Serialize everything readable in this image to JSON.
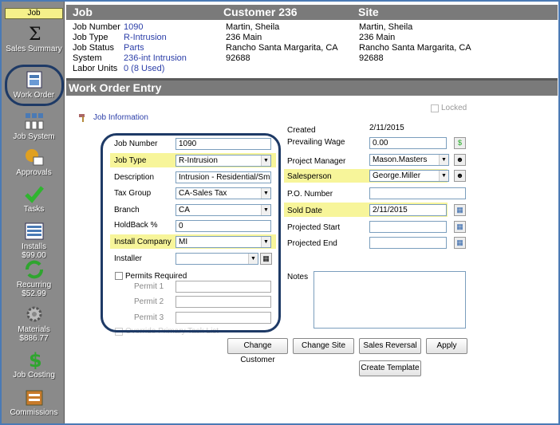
{
  "sidebar": {
    "tab": "Job",
    "items": [
      {
        "label": "Sales Summary",
        "icon": "sigma-icon"
      },
      {
        "label": "Work Order",
        "icon": "work-order-icon"
      },
      {
        "label": "Job System",
        "icon": "job-system-icon"
      },
      {
        "label": "Approvals",
        "icon": "approvals-icon"
      },
      {
        "label": "Tasks",
        "icon": "checkmark-icon"
      },
      {
        "label": "Installs",
        "sub": "$99.00",
        "icon": "installs-icon"
      },
      {
        "label": "Recurring",
        "sub": "$52.99",
        "icon": "recurring-icon"
      },
      {
        "label": "Materials",
        "sub": "$886.77",
        "icon": "gear-icon"
      },
      {
        "label": "Job Costing",
        "icon": "dollar-icon"
      },
      {
        "label": "Commissions",
        "icon": "commissions-icon"
      }
    ]
  },
  "header": {
    "job_title": "Job",
    "customer_title": "Customer 236",
    "site_title": "Site",
    "job_fields": [
      {
        "label": "Job Number",
        "value": "1090"
      },
      {
        "label": "Job Type",
        "value": "R-Intrusion"
      },
      {
        "label": "Job Status",
        "value": "Parts"
      },
      {
        "label": "System",
        "value": "236-int Intrusion"
      },
      {
        "label": "Labor Units",
        "value": "0 (8 Used)"
      }
    ],
    "customer_lines": [
      "Martin, Sheila",
      "236 Main",
      "Rancho Santa Margarita, CA",
      "92688"
    ],
    "site_lines": [
      "Martin, Sheila",
      "236 Main",
      "Rancho Santa Margarita, CA",
      "92688"
    ]
  },
  "section_title": "Work Order Entry",
  "locked_label": "Locked",
  "job_information_link": "Job Information",
  "form": {
    "job_number_label": "Job Number",
    "job_number": "1090",
    "job_type_label": "Job Type",
    "job_type": "R-Intrusion",
    "description_label": "Description",
    "description": "Intrusion - Residential/Small Co",
    "tax_group_label": "Tax Group",
    "tax_group": "CA-Sales Tax",
    "branch_label": "Branch",
    "branch": "CA",
    "holdback_label": "HoldBack  %",
    "holdback": "0",
    "install_company_label": "Install Company",
    "install_company": "MI",
    "installer_label": "Installer",
    "installer": "",
    "permits_required_label": "Permits Required",
    "permit1_label": "Permit 1",
    "permit2_label": "Permit 2",
    "permit3_label": "Permit 3",
    "hidden_check_label": "Override Primary Task List",
    "created_label": "Created",
    "created": "2/11/2015",
    "prevailing_wage_label": "Prevailing Wage",
    "prevailing_wage": "0.00",
    "project_manager_label": "Project Manager",
    "project_manager": "Mason.Masters",
    "salesperson_label": "Salesperson",
    "salesperson": "George.Miller",
    "po_number_label": "P.O. Number",
    "po_number": "",
    "sold_date_label": "Sold Date",
    "sold_date": "2/11/2015",
    "projected_start_label": "Projected Start",
    "projected_start": "",
    "projected_end_label": "Projected End",
    "projected_end": "",
    "notes_label": "Notes"
  },
  "buttons": {
    "change_customer": "Change Customer",
    "change_site": "Change Site",
    "sales_reversal": "Sales Reversal",
    "apply": "Apply",
    "create_template": "Create Template"
  },
  "colors": {
    "highlight": "#f7f59a",
    "header_gray": "#7a7a7a",
    "sidebar_gray": "#8a8a8a",
    "link_blue": "#2b3ea8",
    "circle_navy": "#1e3a66"
  }
}
